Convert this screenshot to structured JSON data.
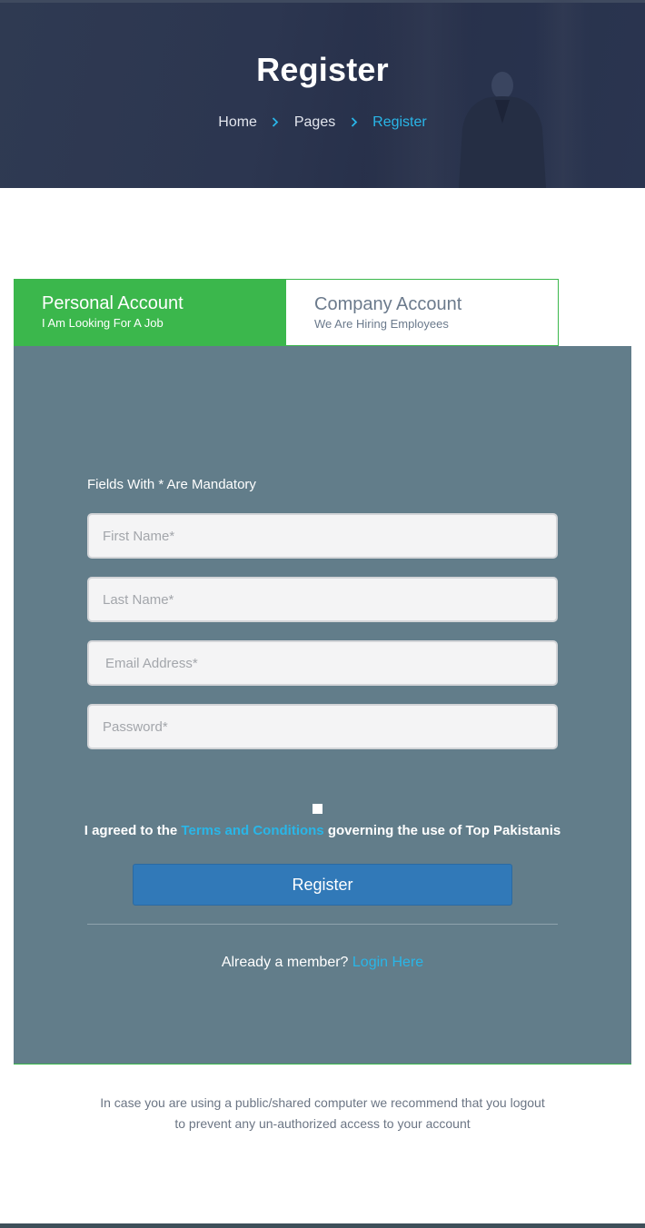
{
  "hero": {
    "title": "Register",
    "breadcrumb": [
      {
        "label": "Home"
      },
      {
        "label": "Pages"
      },
      {
        "label": "Register"
      }
    ]
  },
  "tabs": [
    {
      "title": "Personal Account",
      "subtitle": "I Am Looking For A Job",
      "active": true
    },
    {
      "title": "Company Account",
      "subtitle": "We Are Hiring Employees",
      "active": false
    }
  ],
  "form": {
    "mandatory_note": "Fields With * Are Mandatory",
    "fields": {
      "first_name": {
        "placeholder": "First Name*",
        "value": ""
      },
      "last_name": {
        "placeholder": "Last Name*",
        "value": ""
      },
      "email": {
        "placeholder": "Email Address*",
        "value": ""
      },
      "password": {
        "placeholder": "Password*",
        "value": ""
      }
    },
    "agree_prefix": "I agreed to the ",
    "agree_link": "Terms and Conditions",
    "agree_suffix": " governing the use of Top Pakistanis",
    "agree_checked": false,
    "submit_label": "Register",
    "member_prefix": "Already a member? ",
    "member_link": "Login Here"
  },
  "note": {
    "line1": "In case you are using a public/shared computer we recommend that you logout",
    "line2": "to prevent any un-authorized access to your account"
  },
  "colors": {
    "accent_green": "#3bb74c",
    "link_blue": "#29b6e8",
    "panel_bg": "#627d8a",
    "button_blue": "#3179b8",
    "hero_bg": "#2c3650"
  },
  "icons": {
    "breadcrumb_separator": "chevron-right-icon"
  }
}
